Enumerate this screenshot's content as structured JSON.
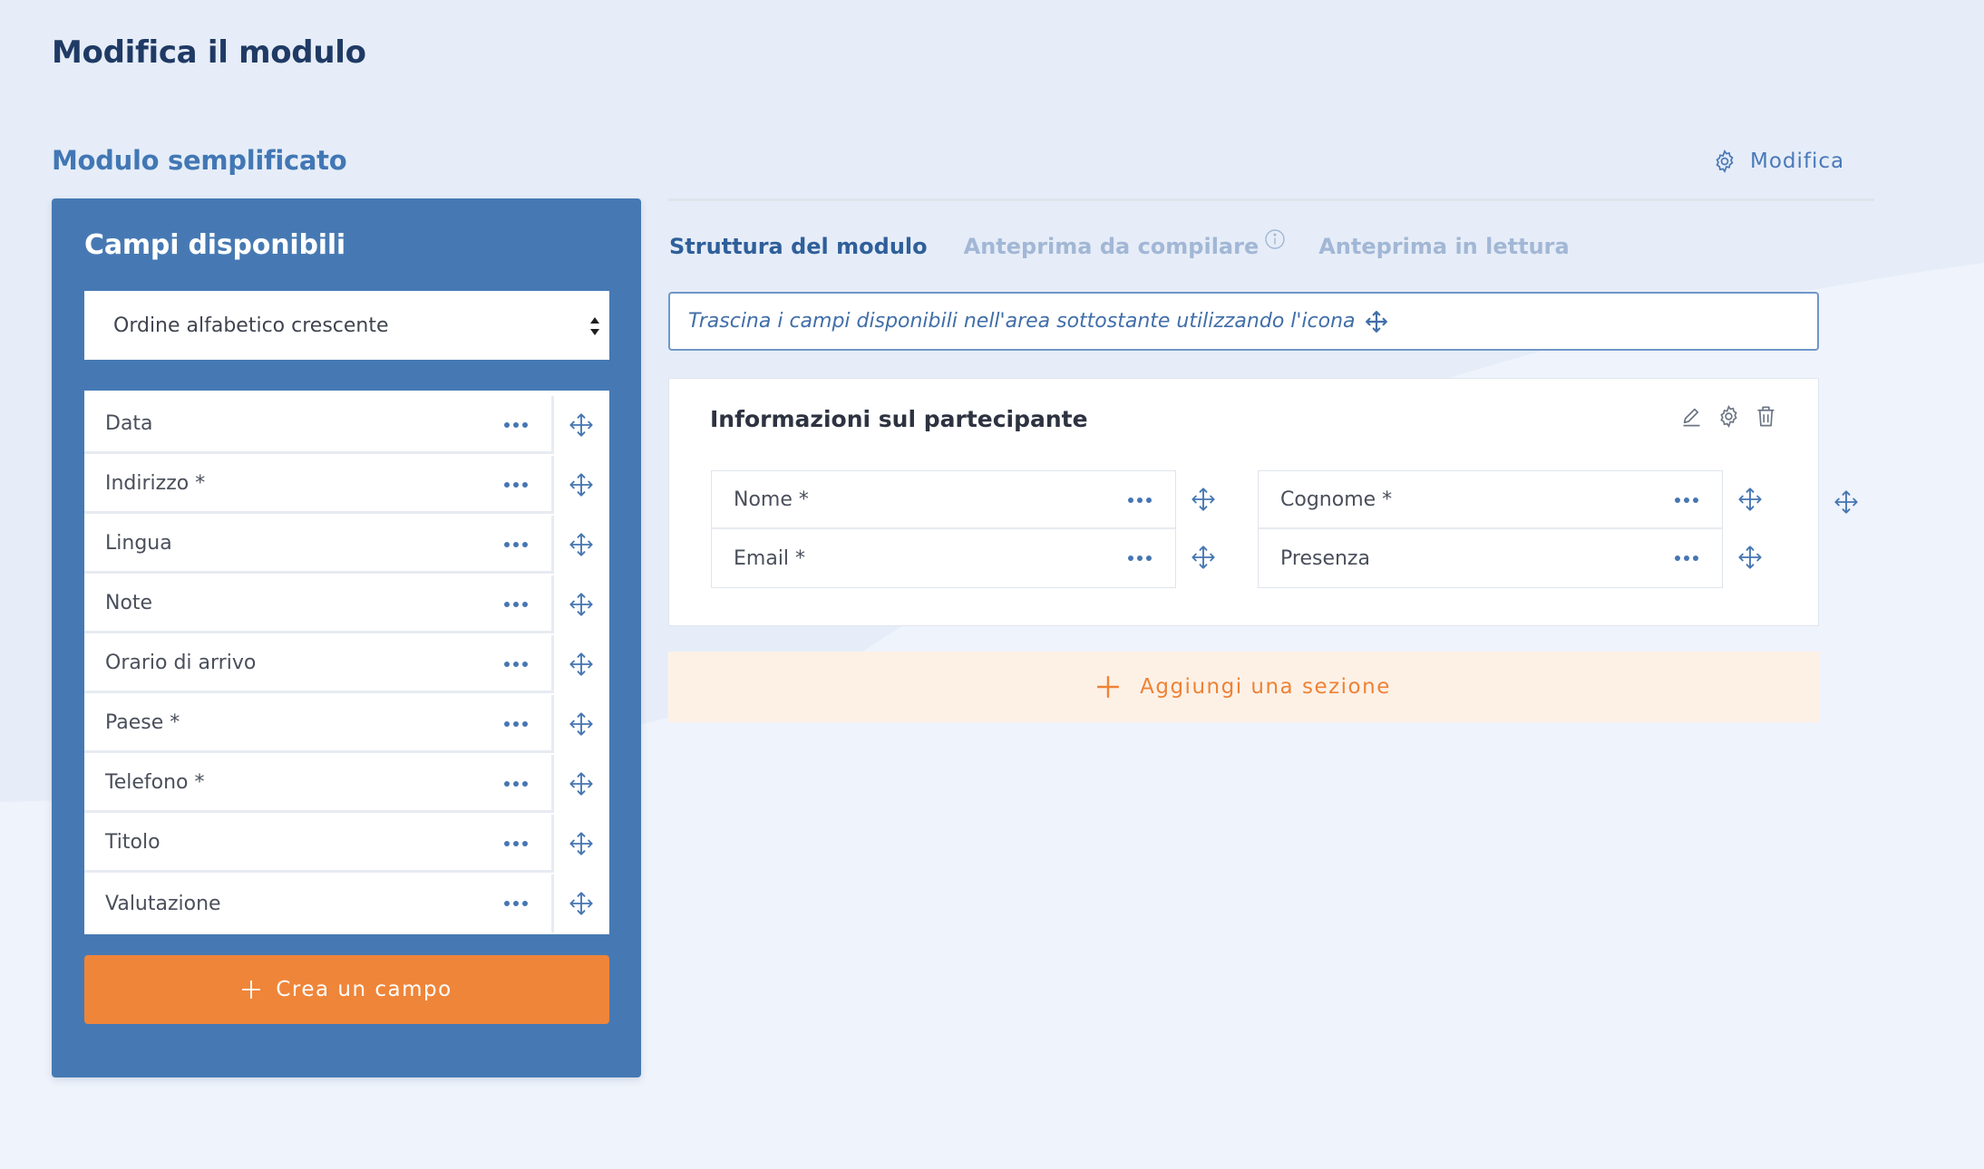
{
  "page": {
    "title": "Modifica il modulo",
    "form_name": "Modulo semplificato",
    "modify_label": "Modifica"
  },
  "colors": {
    "panel_blue": "#4679b3",
    "accent_orange": "#ef8539",
    "title_navy": "#1f3a64",
    "link_blue": "#4a79b8"
  },
  "available_fields": {
    "title": "Campi disponibili",
    "sort": {
      "selected": "Ordine alfabetico crescente"
    },
    "items": [
      {
        "label": "Data"
      },
      {
        "label": "Indirizzo *"
      },
      {
        "label": "Lingua"
      },
      {
        "label": "Note"
      },
      {
        "label": "Orario di arrivo"
      },
      {
        "label": "Paese *"
      },
      {
        "label": "Telefono *"
      },
      {
        "label": "Titolo"
      },
      {
        "label": "Valutazione"
      }
    ],
    "create_button": "Crea un campo"
  },
  "tabs": [
    {
      "label": "Struttura del modulo",
      "active": true
    },
    {
      "label": "Anteprima da compilare",
      "active": false,
      "icon": "info-icon"
    },
    {
      "label": "Anteprima in lettura",
      "active": false
    }
  ],
  "hint": {
    "text": "Trascina i campi disponibili nell'area sottostante utilizzando l'icona",
    "icon": "move-icon"
  },
  "section": {
    "title": "Informazioni sul partecipante",
    "tools": [
      "edit-icon",
      "gear-icon",
      "trash-icon"
    ],
    "columns": [
      {
        "fields": [
          {
            "label": "Nome *"
          },
          {
            "label": "Email *"
          }
        ]
      },
      {
        "fields": [
          {
            "label": "Cognome *"
          },
          {
            "label": "Presenza"
          }
        ]
      }
    ]
  },
  "add_section": {
    "label": "Aggiungi una sezione"
  }
}
